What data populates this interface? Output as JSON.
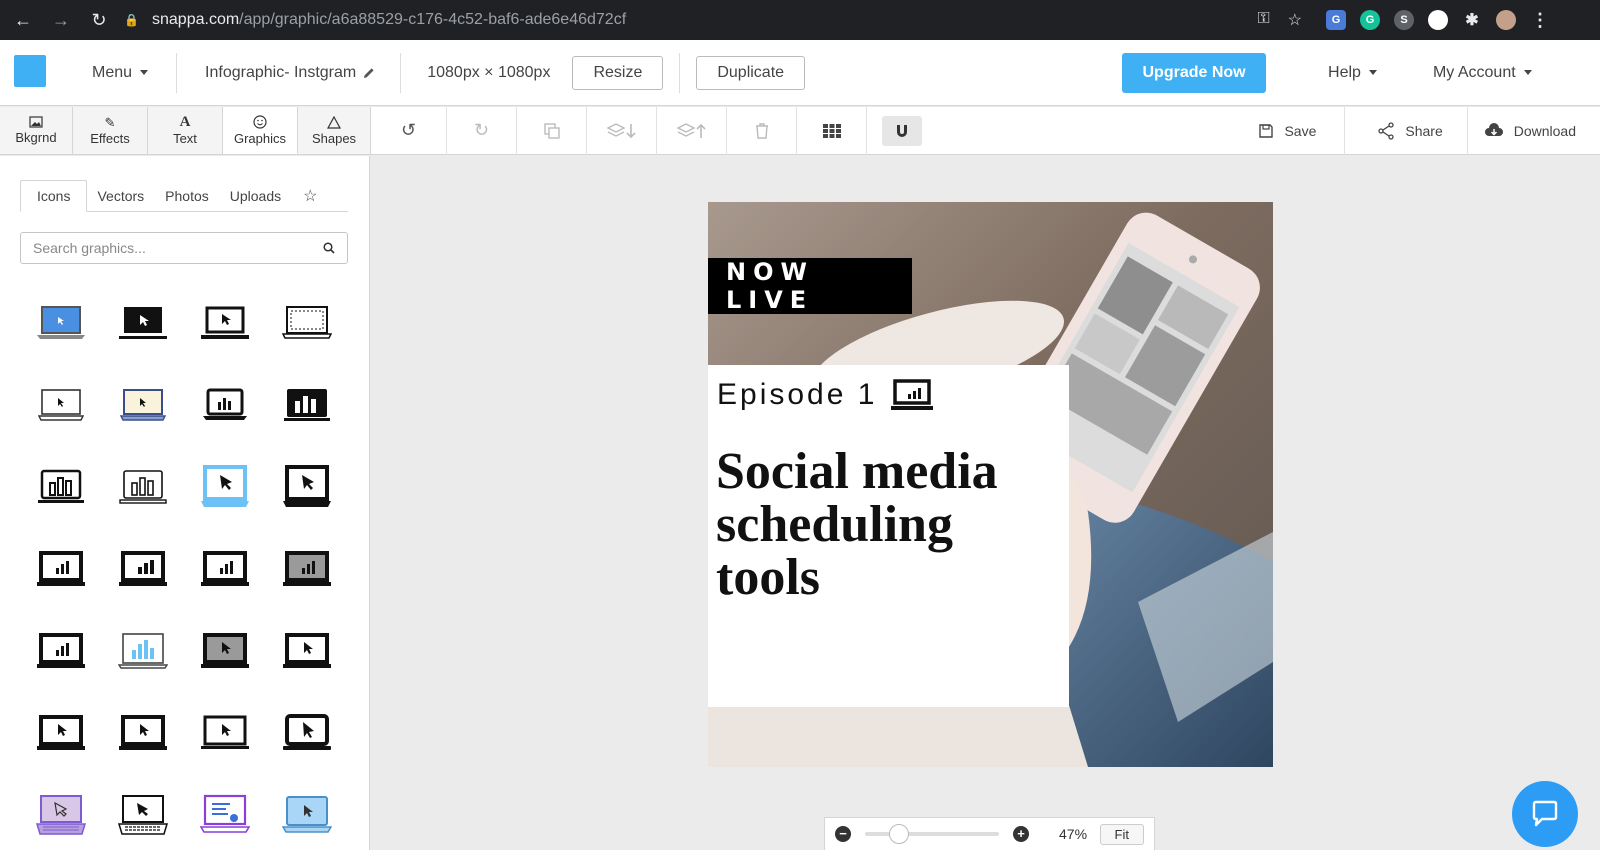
{
  "browser": {
    "host": "snappa.com",
    "path": "/app/graphic/a6a88529-c176-4c52-baf6-ade6e46d72cf"
  },
  "topbar": {
    "menu_label": "Menu",
    "doc_title": "Infographic- Instgram",
    "dimensions": "1080px × 1080px",
    "resize_label": "Resize",
    "duplicate_label": "Duplicate",
    "upgrade_label": "Upgrade Now",
    "help_label": "Help",
    "account_label": "My Account"
  },
  "tooltabs": [
    {
      "label": "Bkgrnd",
      "icon": "image-icon"
    },
    {
      "label": "Effects",
      "icon": "magic-wand-icon"
    },
    {
      "label": "Text",
      "icon": "text-icon"
    },
    {
      "label": "Graphics",
      "icon": "smiley-icon"
    },
    {
      "label": "Shapes",
      "icon": "triangle-icon"
    }
  ],
  "toolbar": {
    "save_label": "Save",
    "share_label": "Share",
    "download_label": "Download"
  },
  "panel": {
    "subtabs": [
      "Icons",
      "Vectors",
      "Photos",
      "Uploads"
    ],
    "search_placeholder": "Search graphics..."
  },
  "canvas": {
    "badge": "NOW LIVE",
    "episode": "Episode 1",
    "headline_line1": "Social media",
    "headline_line2": "scheduling",
    "headline_line3": "tools"
  },
  "zoom": {
    "value": "47%",
    "fit_label": "Fit",
    "level_fraction": 0.25
  },
  "colors": {
    "accent": "#3fb0f4",
    "logo_purple": "#7c5bd3",
    "chat": "#2d9cf5"
  }
}
